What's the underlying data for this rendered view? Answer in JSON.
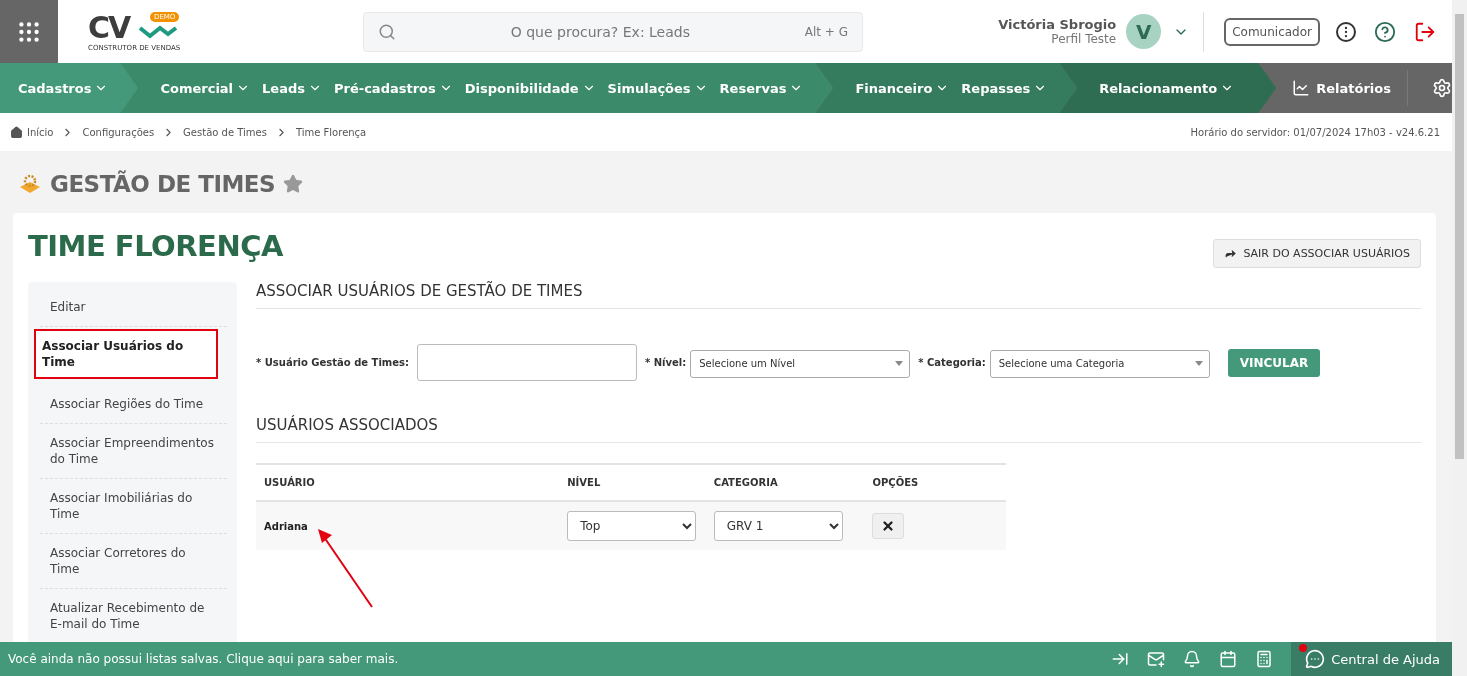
{
  "header": {
    "logo_text": "CV",
    "logo_badge": "DEMO",
    "logo_caption": "CONSTRUTOR DE VENDAS",
    "search": {
      "placeholder": "O que procura? Ex: Leads",
      "shortcut": "Alt + G"
    },
    "user": {
      "name": "Victória Sbrogio",
      "profile": "Perfil Teste",
      "avatar": "V"
    },
    "communicator": "Comunicador"
  },
  "nav": {
    "groups": [
      {
        "color": "#43997a",
        "items": [
          "Cadastros"
        ]
      },
      {
        "color": "#3b8a69",
        "items": [
          "Comercial",
          "Leads",
          "Pré-cadastros",
          "Disponibilidade",
          "Simulações",
          "Reservas"
        ]
      },
      {
        "color": "#357c5e",
        "items": [
          "Financeiro",
          "Repasses"
        ]
      },
      {
        "color": "#2f6d52",
        "items": [
          "Relacionamento"
        ]
      }
    ],
    "reports": "Relatórios"
  },
  "breadcrumb": {
    "items": [
      "Início",
      "Configurações",
      "Gestão de Times",
      "Time Florença"
    ],
    "server_time": "Horário do servidor: 01/07/2024 17h03 - v24.6.21"
  },
  "page_title": "GESTÃO DE TIMES",
  "favorite": false,
  "card": {
    "title": "TIME FLORENÇA",
    "exit_button": "SAIR DO ASSOCIAR USUÁRIOS",
    "sidebar": [
      {
        "label": "Editar",
        "selected": false
      },
      {
        "label": "Associar Usuários do Time",
        "selected": true
      },
      {
        "label": "Associar Regiões do Time",
        "selected": false
      },
      {
        "label": "Associar Empreendimentos do Time",
        "selected": false
      },
      {
        "label": "Associar Imobiliárias do Time",
        "selected": false
      },
      {
        "label": "Associar Corretores do Time",
        "selected": false
      },
      {
        "label": "Atualizar Recebimento de E-mail do Time",
        "selected": false
      }
    ],
    "form": {
      "title": "ASSOCIAR USUÁRIOS DE GESTÃO DE TIMES",
      "user_label": "* Usuário Gestão de Times:",
      "level_label": "* Nível:",
      "level_placeholder": "Selecione um Nível",
      "category_label": "* Categoria:",
      "category_placeholder": "Selecione uma Categoria",
      "submit": "VINCULAR"
    },
    "table": {
      "title": "USUÁRIOS ASSOCIADOS",
      "columns": [
        "USUÁRIO",
        "NÍVEL",
        "CATEGORIA",
        "OPÇÕES"
      ],
      "rows": [
        {
          "user": "Adriana",
          "level": "Top",
          "category": "GRV 1"
        }
      ]
    }
  },
  "footer": {
    "message": "Você ainda não possui listas salvas. Clique aqui para saber mais.",
    "help": "Central de Ajuda"
  }
}
